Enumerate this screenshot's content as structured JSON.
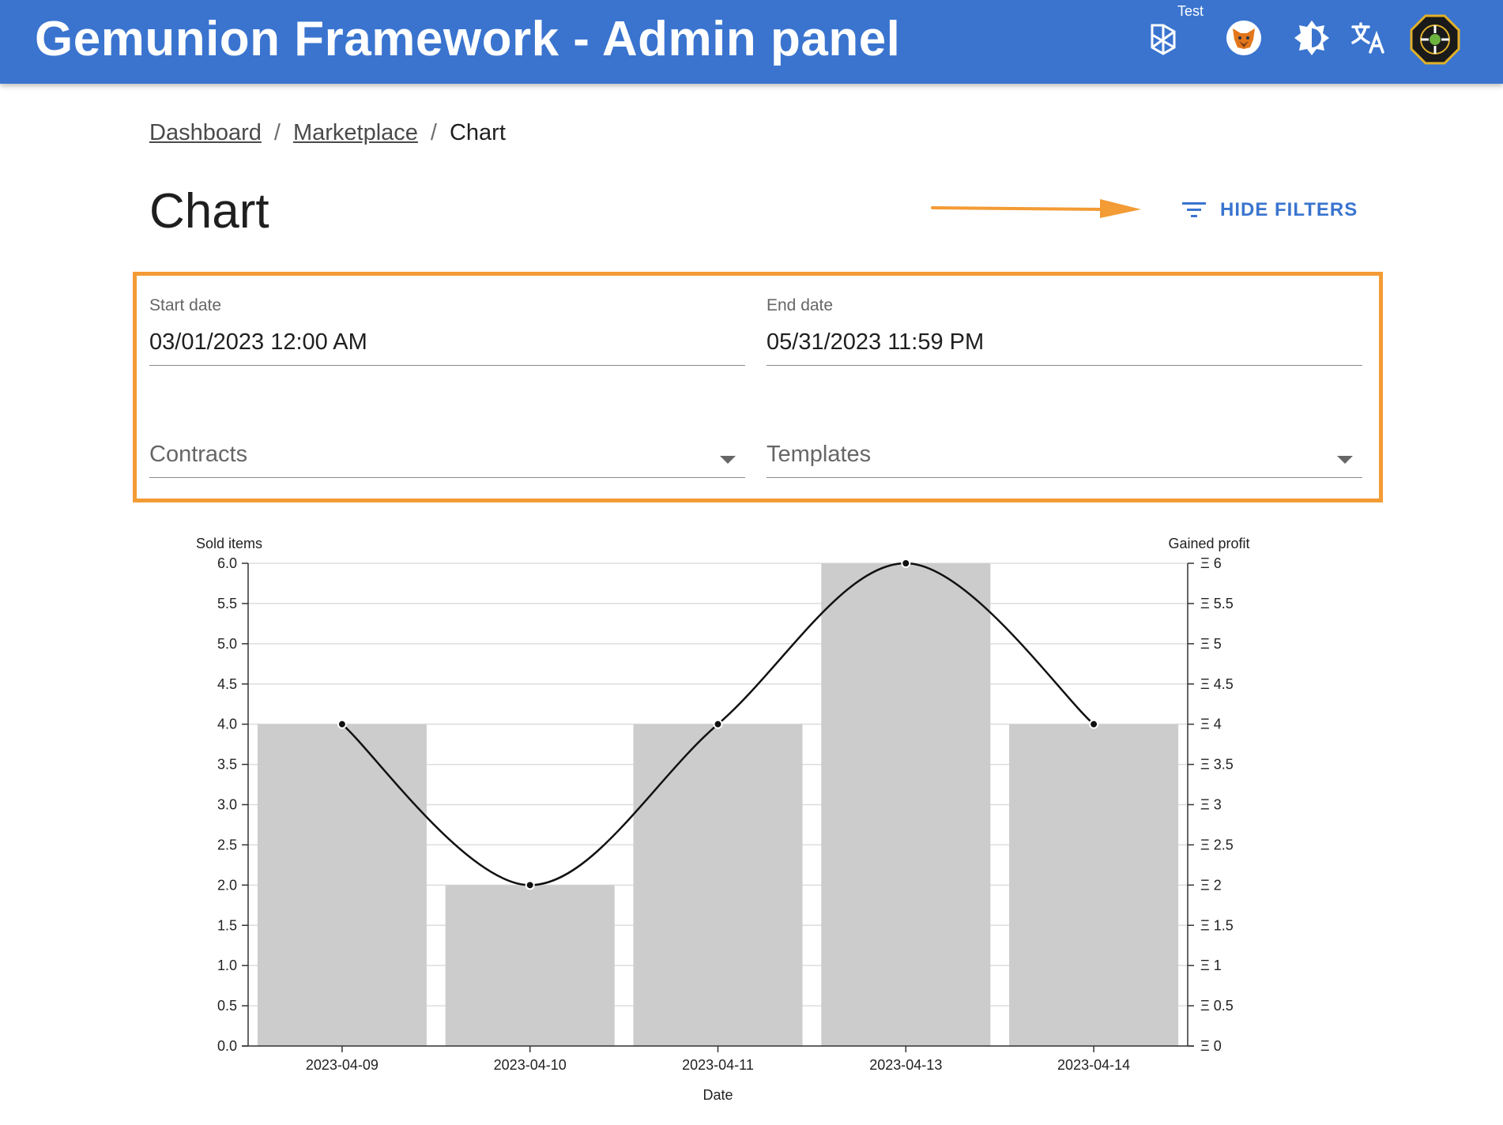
{
  "app": {
    "title": "Gemunion Framework - Admin panel",
    "network_label": "Test"
  },
  "toolbar_icons": [
    "network-icon",
    "metamask-fox-icon",
    "theme-toggle-icon",
    "language-icon",
    "gemunion-logo-icon"
  ],
  "colors": {
    "appbar": "#3a74cf",
    "accent": "#3a74cf",
    "highlight": "#f39b34",
    "bar": "#cccccc"
  },
  "breadcrumb": {
    "items": [
      "Dashboard",
      "Marketplace"
    ],
    "current": "Chart"
  },
  "page": {
    "title": "Chart",
    "hide_filters_label": "HIDE FILTERS"
  },
  "filters": {
    "start_date": {
      "label": "Start date",
      "value": "03/01/2023 12:00 AM"
    },
    "end_date": {
      "label": "End date",
      "value": "05/31/2023 11:59 PM"
    },
    "contracts": {
      "label": "Contracts"
    },
    "templates": {
      "label": "Templates"
    }
  },
  "chart_data": {
    "type": "bar",
    "categories": [
      "2023-04-09",
      "2023-04-10",
      "2023-04-11",
      "2023-04-13",
      "2023-04-14"
    ],
    "series": [
      {
        "name": "Sold items",
        "type": "bar",
        "axis": "left",
        "values": [
          4,
          2,
          4,
          6,
          4
        ]
      },
      {
        "name": "Gained profit",
        "type": "line",
        "axis": "right",
        "values": [
          4,
          2,
          4,
          6,
          4
        ]
      }
    ],
    "xlabel": "Date",
    "ylabel": "Sold items",
    "y2label": "Gained profit",
    "ylim": [
      0,
      6
    ],
    "y2lim": [
      0,
      6
    ],
    "yticks": [
      "0.0",
      "0.5",
      "1.0",
      "1.5",
      "2.0",
      "2.5",
      "3.0",
      "3.5",
      "4.0",
      "4.5",
      "5.0",
      "5.5",
      "6.0"
    ],
    "y2ticks": [
      "Ξ 0",
      "Ξ 0.5",
      "Ξ 1",
      "Ξ 1.5",
      "Ξ 2",
      "Ξ 2.5",
      "Ξ 3",
      "Ξ 3.5",
      "Ξ 4",
      "Ξ 4.5",
      "Ξ 5",
      "Ξ 5.5",
      "Ξ 6"
    ],
    "grid": true
  }
}
